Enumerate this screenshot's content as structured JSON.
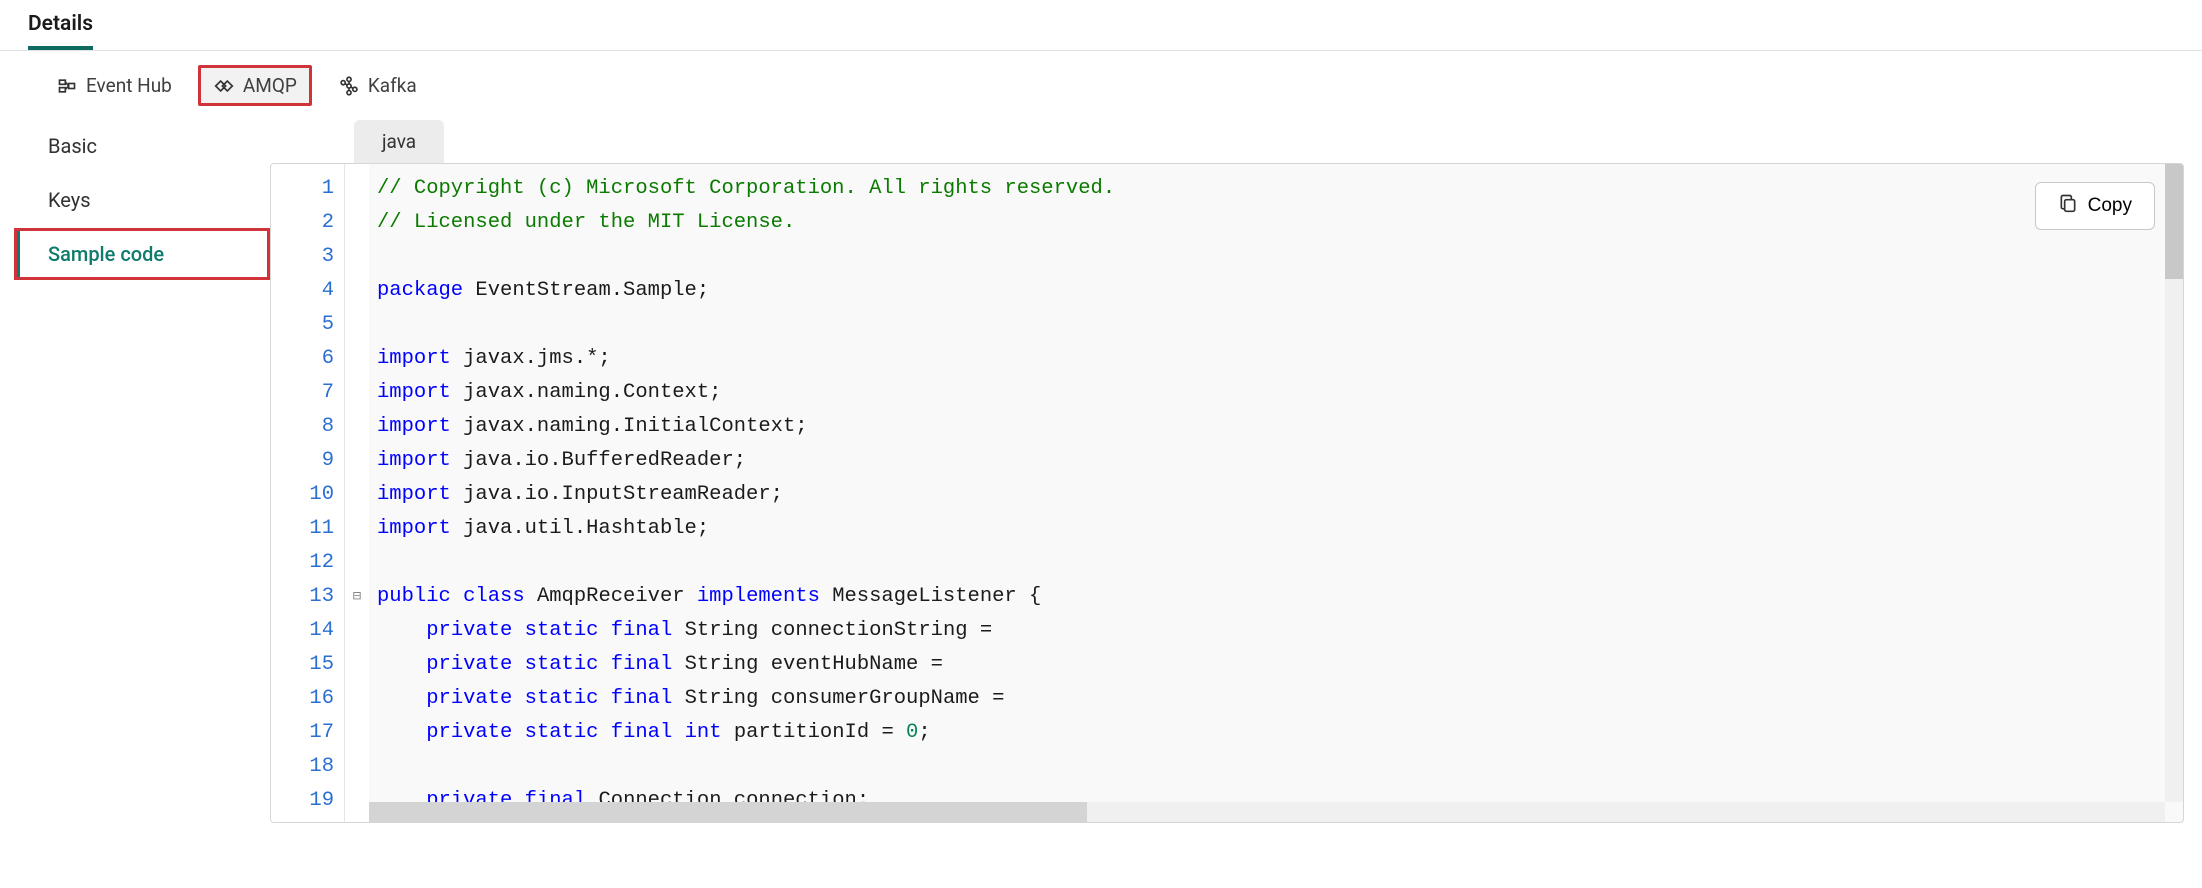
{
  "header": {
    "title": "Details"
  },
  "protocolTabs": [
    {
      "label": "Event Hub"
    },
    {
      "label": "AMQP"
    },
    {
      "label": "Kafka"
    }
  ],
  "sidebar": {
    "items": [
      {
        "label": "Basic"
      },
      {
        "label": "Keys"
      },
      {
        "label": "Sample code"
      }
    ]
  },
  "langTab": "java",
  "copyLabel": "Copy",
  "code": {
    "lines": [
      {
        "n": 1,
        "segs": [
          {
            "t": "// Copyright (c) Microsoft Corporation. All rights reserved.",
            "c": "tok-comment"
          }
        ]
      },
      {
        "n": 2,
        "segs": [
          {
            "t": "// Licensed under the MIT License.",
            "c": "tok-comment"
          }
        ]
      },
      {
        "n": 3,
        "segs": []
      },
      {
        "n": 4,
        "segs": [
          {
            "t": "package",
            "c": "tok-kw"
          },
          {
            "t": " EventStream.Sample;"
          }
        ]
      },
      {
        "n": 5,
        "segs": []
      },
      {
        "n": 6,
        "segs": [
          {
            "t": "import",
            "c": "tok-kw"
          },
          {
            "t": " javax.jms.*;"
          }
        ]
      },
      {
        "n": 7,
        "segs": [
          {
            "t": "import",
            "c": "tok-kw"
          },
          {
            "t": " javax.naming.Context;"
          }
        ]
      },
      {
        "n": 8,
        "segs": [
          {
            "t": "import",
            "c": "tok-kw"
          },
          {
            "t": " javax.naming.InitialContext;"
          }
        ]
      },
      {
        "n": 9,
        "segs": [
          {
            "t": "import",
            "c": "tok-kw"
          },
          {
            "t": " java.io.BufferedReader;"
          }
        ]
      },
      {
        "n": 10,
        "segs": [
          {
            "t": "import",
            "c": "tok-kw"
          },
          {
            "t": " java.io.InputStreamReader;"
          }
        ]
      },
      {
        "n": 11,
        "segs": [
          {
            "t": "import",
            "c": "tok-kw"
          },
          {
            "t": " java.util.Hashtable;"
          }
        ]
      },
      {
        "n": 12,
        "segs": []
      },
      {
        "n": 13,
        "fold": "⊟",
        "segs": [
          {
            "t": "public",
            "c": "tok-kw"
          },
          {
            "t": " "
          },
          {
            "t": "class",
            "c": "tok-kw"
          },
          {
            "t": " AmqpReceiver "
          },
          {
            "t": "implements",
            "c": "tok-kw"
          },
          {
            "t": " MessageListener {"
          }
        ]
      },
      {
        "n": 14,
        "segs": [
          {
            "t": "    "
          },
          {
            "t": "private",
            "c": "tok-kw"
          },
          {
            "t": " "
          },
          {
            "t": "static",
            "c": "tok-kw"
          },
          {
            "t": " "
          },
          {
            "t": "final",
            "c": "tok-kw"
          },
          {
            "t": " String connectionString ="
          }
        ]
      },
      {
        "n": 15,
        "segs": [
          {
            "t": "    "
          },
          {
            "t": "private",
            "c": "tok-kw"
          },
          {
            "t": " "
          },
          {
            "t": "static",
            "c": "tok-kw"
          },
          {
            "t": " "
          },
          {
            "t": "final",
            "c": "tok-kw"
          },
          {
            "t": " String eventHubName ="
          }
        ]
      },
      {
        "n": 16,
        "segs": [
          {
            "t": "    "
          },
          {
            "t": "private",
            "c": "tok-kw"
          },
          {
            "t": " "
          },
          {
            "t": "static",
            "c": "tok-kw"
          },
          {
            "t": " "
          },
          {
            "t": "final",
            "c": "tok-kw"
          },
          {
            "t": " String consumerGroupName ="
          }
        ]
      },
      {
        "n": 17,
        "segs": [
          {
            "t": "    "
          },
          {
            "t": "private",
            "c": "tok-kw"
          },
          {
            "t": " "
          },
          {
            "t": "static",
            "c": "tok-kw"
          },
          {
            "t": " "
          },
          {
            "t": "final",
            "c": "tok-kw"
          },
          {
            "t": " "
          },
          {
            "t": "int",
            "c": "tok-kw"
          },
          {
            "t": " partitionId = "
          },
          {
            "t": "0",
            "c": "tok-num"
          },
          {
            "t": ";"
          }
        ]
      },
      {
        "n": 18,
        "segs": []
      },
      {
        "n": 19,
        "segs": [
          {
            "t": "    "
          },
          {
            "t": "private",
            "c": "tok-kw"
          },
          {
            "t": " "
          },
          {
            "t": "final",
            "c": "tok-kw"
          },
          {
            "t": " Connection connection;"
          }
        ]
      }
    ]
  }
}
